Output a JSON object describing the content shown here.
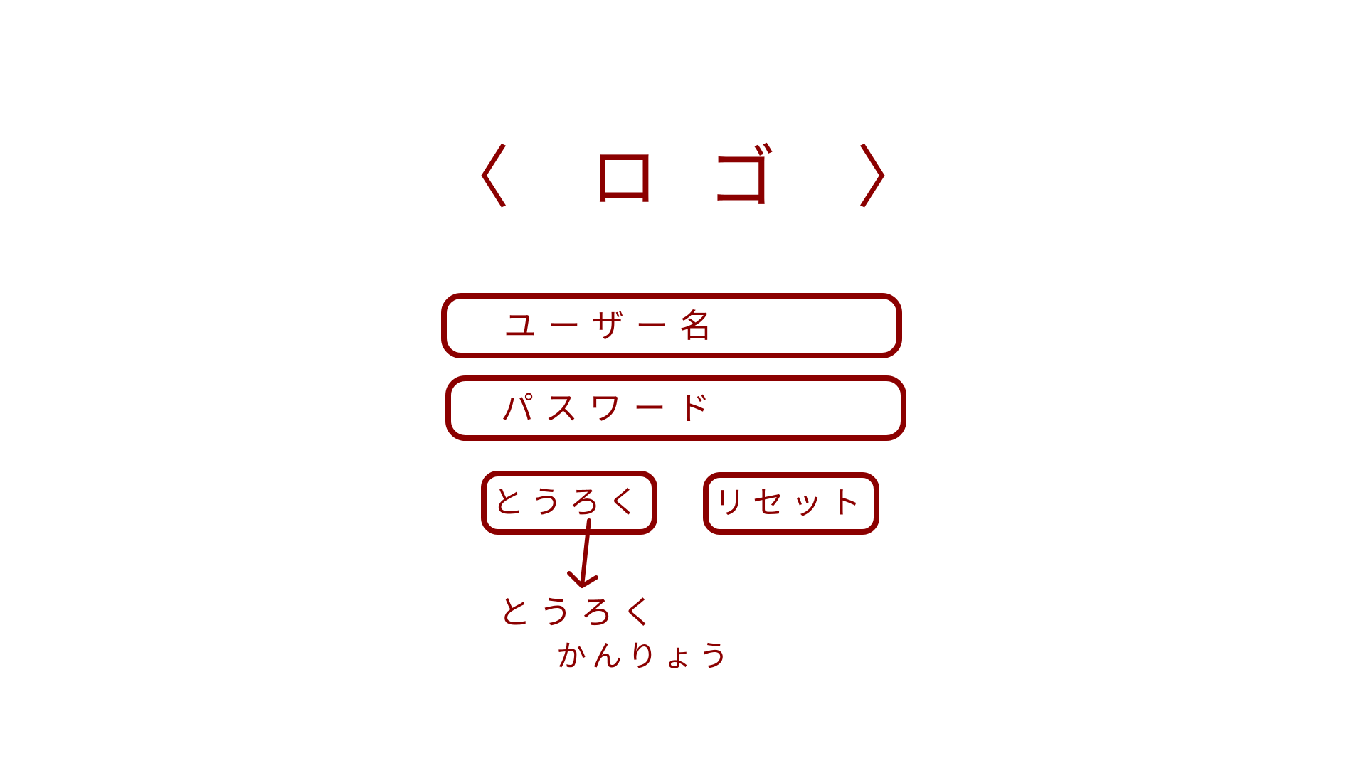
{
  "logo": {
    "open_bracket": "〈",
    "text": "ロゴ",
    "close_bracket": "〉"
  },
  "form": {
    "username_label": "ユーザー名",
    "password_label": "パスワード"
  },
  "buttons": {
    "register_label": "とうろく",
    "reset_label": "リセット"
  },
  "annotation": {
    "line1": "とうろく",
    "line2": "かんりょう"
  },
  "colors": {
    "ink": "#8b0000",
    "background": "#ffffff"
  }
}
